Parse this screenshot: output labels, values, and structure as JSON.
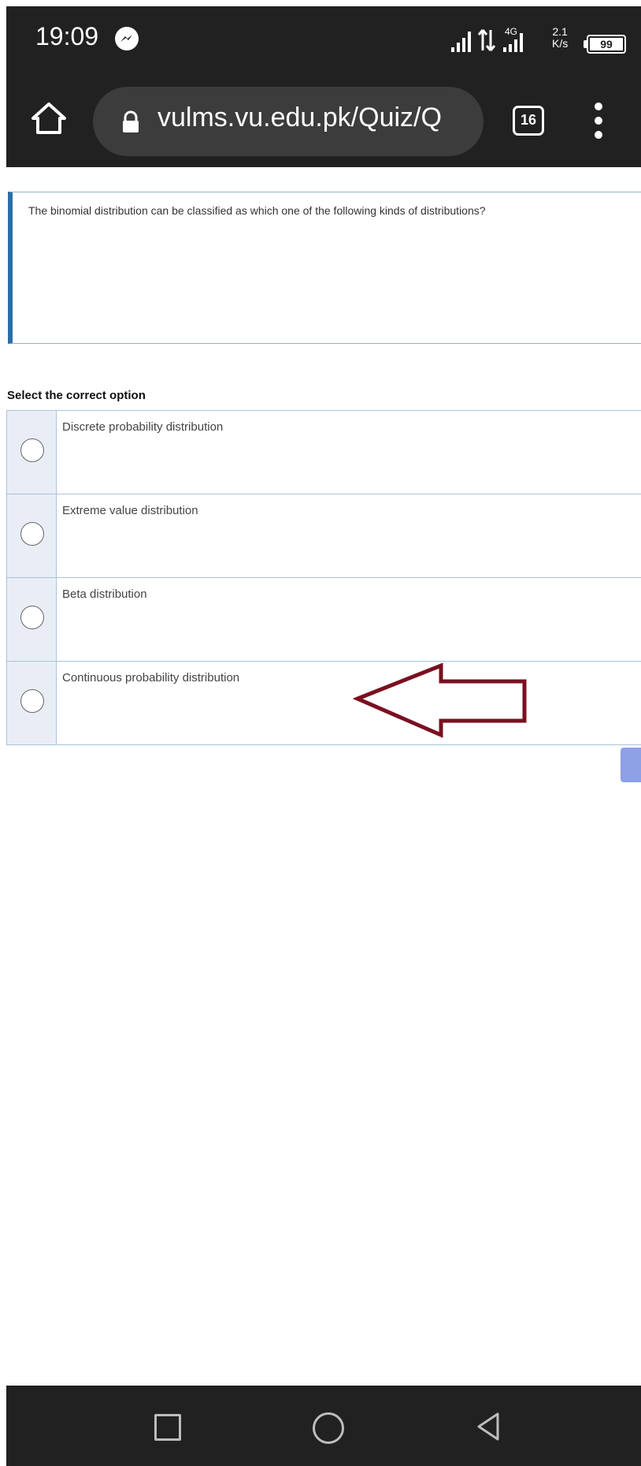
{
  "status_bar": {
    "time": "19:09",
    "network": "4G",
    "speed_value": "2.1",
    "speed_unit": "K/s",
    "battery": "99",
    "icons": [
      "messenger-icon",
      "signal-bars-icon",
      "data-arrows-icon",
      "4g-signal-icon",
      "battery-icon"
    ]
  },
  "browser": {
    "url": "vulms.vu.edu.pk/Quiz/Q",
    "tab_count": "16",
    "icons": [
      "home-icon",
      "lock-icon",
      "tabs-icon",
      "more-vert-icon"
    ]
  },
  "quiz": {
    "question_text": "The binomial distribution can be classified as which one of the following kinds of distributions?",
    "select_label": "Select the correct option",
    "options": [
      {
        "label": "Discrete probability distribution"
      },
      {
        "label": "Extreme value distribution"
      },
      {
        "label": "Beta distribution"
      },
      {
        "label": "Continuous probability distribution"
      }
    ],
    "annotation": "arrow-pointing-left-icon",
    "annotation_color": "#7a1020",
    "accent_color": "#2a6ea6",
    "button_color": "#8ea0e6"
  },
  "nav_bar": {
    "icons": [
      "recents-icon",
      "home-circle-icon",
      "back-icon"
    ]
  }
}
